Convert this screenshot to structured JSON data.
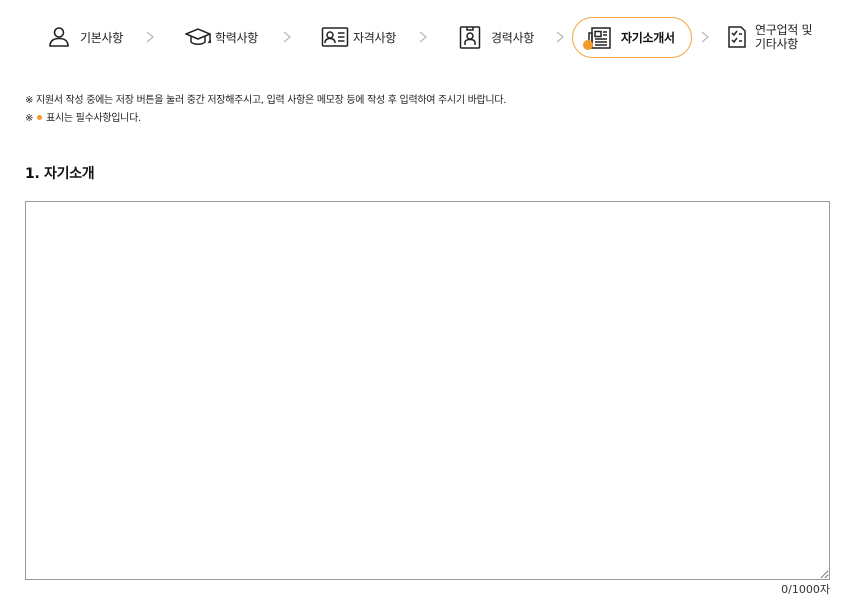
{
  "steps": [
    {
      "label": "기본사항",
      "icon": "person-icon"
    },
    {
      "label": "학력사항",
      "icon": "graduation-cap-icon"
    },
    {
      "label": "자격사항",
      "icon": "id-card-icon"
    },
    {
      "label": "경력사항",
      "icon": "badge-icon"
    },
    {
      "label": "자기소개서",
      "icon": "newspaper-icon",
      "active": true
    },
    {
      "label_line1": "연구업적 및",
      "label_line2": "기타사항",
      "icon": "checklist-icon"
    }
  ],
  "notice": {
    "line1": "※ 지원서 작성 중에는 저장 버튼을 눌러 중간 저장해주시고, 입력 사항은 메모장 등에 작성 후 입력하여 주시기 바랍니다.",
    "line2_prefix": "※",
    "line2_text": "표시는 필수사항입니다."
  },
  "section": {
    "title": "1. 자기소개",
    "textarea_value": "",
    "counter": "0/1000자"
  },
  "colors": {
    "accent": "#f39a2b",
    "active_border": "#f3a640"
  }
}
